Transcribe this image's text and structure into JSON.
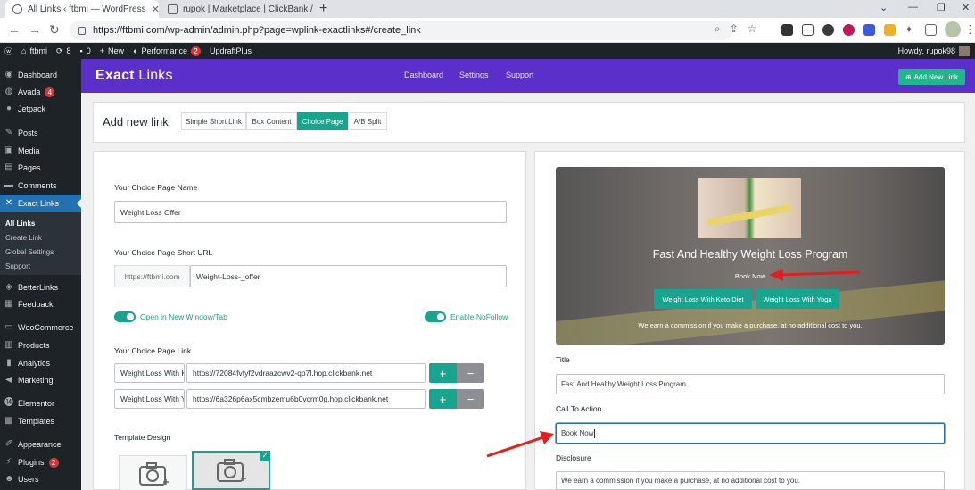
{
  "browser": {
    "tabs": [
      {
        "title": "All Links ‹ ftbmi — WordPress",
        "active": true
      },
      {
        "title": "rupok | Marketplace | ClickBank /",
        "active": false
      }
    ],
    "url": "https://ftbmi.com/wp-admin/admin.php?page=wplink-exactlinks#/create_link"
  },
  "adminbar": {
    "site": "ftbmi",
    "updates": "8",
    "comments": "0",
    "new": "New",
    "performance": "Performance",
    "performance_count": "2",
    "updraft": "UpdraftPlus",
    "howdy": "Howdy, rupok98"
  },
  "sidebar": {
    "items": [
      {
        "label": "Dashboard",
        "icon": "dashboard-icon"
      },
      {
        "label": "Avada",
        "icon": "avada-icon",
        "badge": "4"
      },
      {
        "label": "Jetpack",
        "icon": "jetpack-icon"
      },
      {
        "label": "Posts",
        "icon": "pin-icon"
      },
      {
        "label": "Media",
        "icon": "media-icon"
      },
      {
        "label": "Pages",
        "icon": "pages-icon"
      },
      {
        "label": "Comments",
        "icon": "comments-icon"
      },
      {
        "label": "Exact Links",
        "icon": "exactlinks-icon"
      },
      {
        "label": "BetterLinks",
        "icon": "betterlinks-icon"
      },
      {
        "label": "Feedback",
        "icon": "feedback-icon"
      },
      {
        "label": "WooCommerce",
        "icon": "woo-icon"
      },
      {
        "label": "Products",
        "icon": "products-icon"
      },
      {
        "label": "Analytics",
        "icon": "analytics-icon"
      },
      {
        "label": "Marketing",
        "icon": "marketing-icon"
      },
      {
        "label": "Elementor",
        "icon": "elementor-icon"
      },
      {
        "label": "Templates",
        "icon": "templates-icon"
      },
      {
        "label": "Appearance",
        "icon": "appearance-icon"
      },
      {
        "label": "Plugins",
        "icon": "plugins-icon",
        "badge": "2"
      },
      {
        "label": "Users",
        "icon": "users-icon"
      }
    ],
    "sub": [
      "All Links",
      "Create Link",
      "Global Settings",
      "Support"
    ]
  },
  "header": {
    "logo_bold": "Exact",
    "logo_thin": " Links",
    "nav": [
      "Dashboard",
      "Settings",
      "Support"
    ],
    "add_new": "Add New Link"
  },
  "add_panel": {
    "title": "Add new link",
    "types": [
      "Simple Short Link",
      "Box Content",
      "Choice Page",
      "A/B Split"
    ],
    "active_type": "Choice Page"
  },
  "form": {
    "name_label": "Your Choice Page Name",
    "name_value": "Weight Loss Offer",
    "short_url_label": "Your Choice Page Short URL",
    "short_url_prefix": "https://ftbmi.com",
    "short_url_value": "Weight-Loss-_offer",
    "open_new_window": "Open in New Window/Tab",
    "enable_nofollow": "Enable NoFollow",
    "links_label": "Your Choice Page Link",
    "links": [
      {
        "name": "Weight Loss With K",
        "url": "https://72084fvfyf2vdraazcwv2-qo7l.hop.clickbank.net"
      },
      {
        "name": "Weight Loss With Y",
        "url": "https://6a326p6ax5cmbzemu6b0vcrm0g.hop.clickbank.net"
      }
    ],
    "template_label": "Template Design"
  },
  "preview": {
    "title": "Fast And Healthy Weight Loss Program",
    "cta": "Book Now",
    "buttons": [
      "Weight Loss With Keto Diet",
      "Weight Loss With Yoga"
    ],
    "disclosure": "We earn a commission if you make a purchase, at no additional cost to you."
  },
  "right_form": {
    "title_label": "Title",
    "title_value": "Fast And Healthy Weight Loss Program",
    "cta_label": "Call To Action",
    "cta_value": "Book Now",
    "disclosure_label": "Disclosure",
    "disclosure_value": "We earn a commission if you make a purchase, at no additional cost to you."
  },
  "colors": {
    "brand": "#5b2fc9",
    "accent": "#17a58f",
    "wp_sidebar": "#1d2327",
    "wp_current": "#2271b1",
    "arrow": "#e02020"
  }
}
